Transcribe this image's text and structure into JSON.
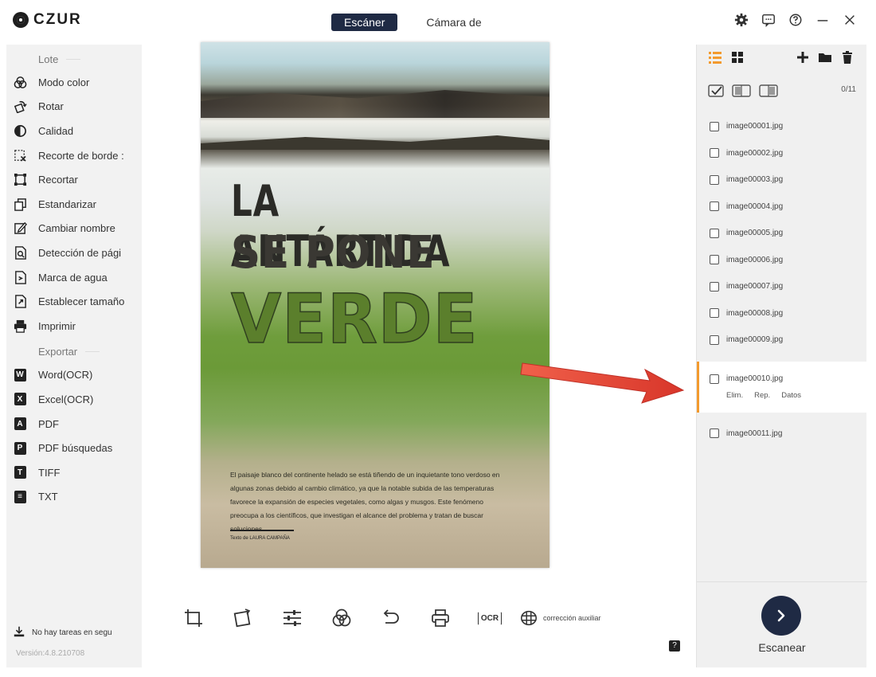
{
  "app": {
    "brand": "CZUR"
  },
  "header": {
    "tabs": [
      {
        "label": "Escáner",
        "active": true
      },
      {
        "label": "Cámara de",
        "active": false
      }
    ],
    "accent": "#1f2a44"
  },
  "left_menu": {
    "batch_header": "Lote",
    "batch_items": [
      {
        "label": "Modo color",
        "icon": "color-mode-icon"
      },
      {
        "label": "Rotar",
        "icon": "rotate-icon"
      },
      {
        "label": "Calidad",
        "icon": "quality-icon"
      },
      {
        "label": "Recorte de borde :",
        "icon": "edge-crop-icon"
      },
      {
        "label": "Recortar",
        "icon": "crop-icon"
      },
      {
        "label": "Estandarizar",
        "icon": "standardize-icon"
      },
      {
        "label": "Cambiar nombre",
        "icon": "rename-icon"
      },
      {
        "label": "Detección de pági",
        "icon": "page-detect-icon"
      },
      {
        "label": "Marca de agua",
        "icon": "watermark-icon"
      },
      {
        "label": "Establecer tamaño",
        "icon": "set-size-icon"
      },
      {
        "label": "Imprimir",
        "icon": "print-icon"
      }
    ],
    "export_header": "Exportar",
    "export_items": [
      {
        "label": "Word(OCR)",
        "badge": "W",
        "icon": "word-icon"
      },
      {
        "label": "Excel(OCR)",
        "badge": "X",
        "icon": "excel-icon"
      },
      {
        "label": "PDF",
        "badge": "A",
        "icon": "pdf-icon"
      },
      {
        "label": "PDF búsquedas",
        "badge": "P",
        "icon": "pdf-search-icon"
      },
      {
        "label": "TIFF",
        "badge": "T",
        "icon": "tiff-icon"
      },
      {
        "label": "TXT",
        "badge": "≡",
        "icon": "txt-icon"
      }
    ],
    "task_status": "No hay tareas en segu",
    "version": "Versión:4.8.210708"
  },
  "preview": {
    "headline_1": "LA ANTÁRTIDA",
    "headline_2": "SE PONE",
    "headline_3": "VERDE",
    "intro": "El paisaje blanco del continente helado se está tiñendo de un inquietante tono verdoso en algunas zonas debido al cambio climático, ya que la notable subida de las temperaturas favorece la expansión de especies vegetales, como algas y musgos. Este fenómeno preocupa a los científicos, que investigan el alcance del problema y tratan de buscar soluciones.",
    "byline": "Texto de LAURA CAMPAÑA"
  },
  "toolbar": {
    "tools": [
      "crop-icon",
      "rotate-icon",
      "adjust-icon",
      "color-icon",
      "undo-icon",
      "print-icon",
      "ocr-icon"
    ],
    "ocr_label": "OCR",
    "aux_label": "corrección auxiliar",
    "help_label": "?"
  },
  "right_panel": {
    "count": "0/11",
    "files": [
      "image00001.jpg",
      "image00002.jpg",
      "image00003.jpg",
      "image00004.jpg",
      "image00005.jpg",
      "image00006.jpg",
      "image00007.jpg",
      "image00008.jpg",
      "image00009.jpg",
      "image00010.jpg",
      "image00011.jpg"
    ],
    "selected_index": 9,
    "selected_actions": [
      "Elim.",
      "Rep.",
      "Datos"
    ],
    "selected_accent": "#f39a2d",
    "scan_label": "Escanear",
    "list_accent": "#f39a2d"
  },
  "annotation": {
    "arrow_color": "#e8463a"
  }
}
